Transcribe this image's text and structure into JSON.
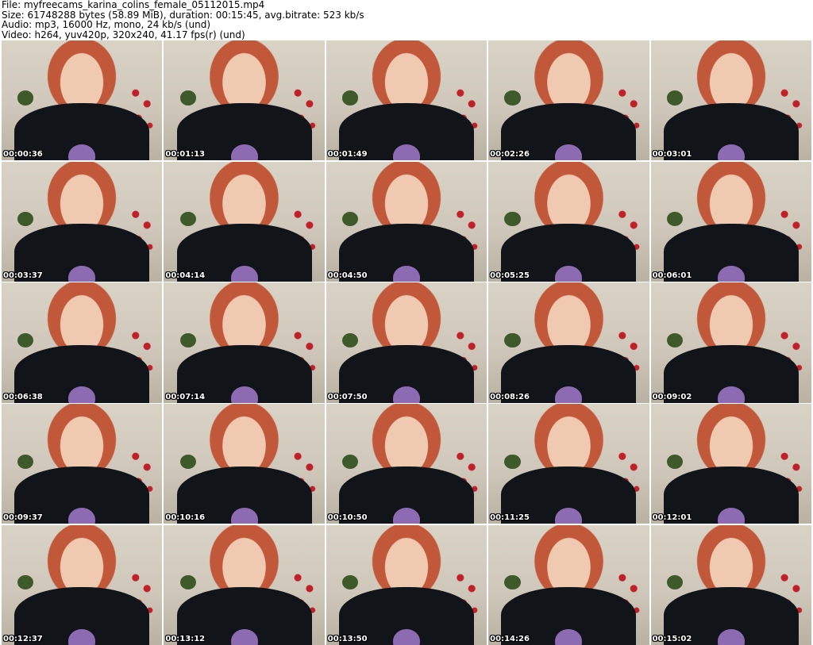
{
  "header": {
    "file": "File: myfreecams_karina_colins_female_05112015.mp4",
    "size": "Size: 61748288 bytes (58.89 MiB), duration: 00:15:45, avg.bitrate: 523 kb/s",
    "audio": "Audio: mp3, 16000 Hz, mono, 24 kb/s (und)",
    "video": "Video: h264, yuv420p, 320x240, 41.17 fps(r) (und)"
  },
  "frames": [
    "00:00:36",
    "00:01:13",
    "00:01:49",
    "00:02:26",
    "00:03:01",
    "00:03:37",
    "00:04:14",
    "00:04:50",
    "00:05:25",
    "00:06:01",
    "00:06:38",
    "00:07:14",
    "00:07:50",
    "00:08:26",
    "00:09:02",
    "00:09:37",
    "00:10:16",
    "00:10:50",
    "00:11:25",
    "00:12:01",
    "00:12:37",
    "00:13:12",
    "00:13:50",
    "00:14:26",
    "00:15:02"
  ]
}
